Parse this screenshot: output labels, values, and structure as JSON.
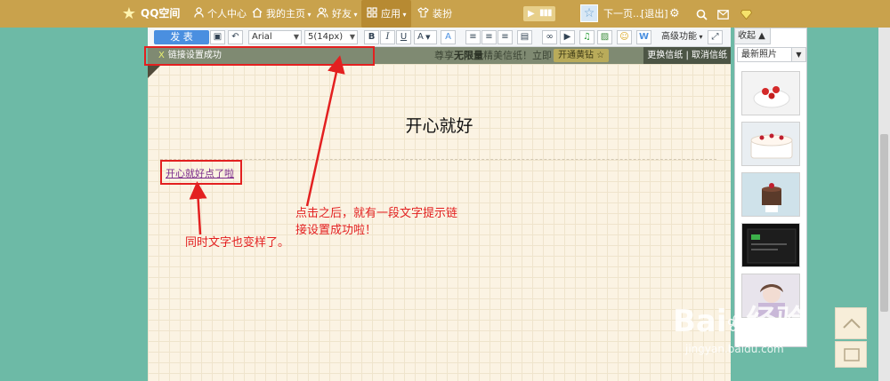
{
  "topbar": {
    "logo": "QQ空间",
    "nav": [
      {
        "label": "个人中心",
        "icon": "person-icon"
      },
      {
        "label": "我的主页",
        "icon": "home-icon"
      },
      {
        "label": "好友",
        "icon": "friends-icon"
      },
      {
        "label": "应用",
        "icon": "apps-icon"
      },
      {
        "label": "装扮",
        "icon": "shirt-icon"
      }
    ],
    "next_page": "下一页...",
    "logout": "[退出]"
  },
  "toolbar": {
    "publish": "发 表",
    "font_family": "Arial",
    "font_size": "5(14px)",
    "bold": "B",
    "italic": "I",
    "underline": "U",
    "font_color": "A",
    "advanced": "高级功能"
  },
  "notice": {
    "close": "X",
    "message": "链接设置成功",
    "promo_prefix": "尊享",
    "promo_bold": "无限量",
    "promo_suffix": "精美信纸！立即",
    "open_vip": "开通黄钻 ☆",
    "change_paper": "更换信纸",
    "separator": "|",
    "cancel_paper": "取消信纸"
  },
  "content": {
    "title": "开心就好",
    "link_text": "开心就好点了啦"
  },
  "annotations": {
    "note_right_line1": "点击之后，就有一段文字提示链",
    "note_right_line2": "接设置成功啦！",
    "note_left": "同时文字也变样了。"
  },
  "sidebar": {
    "tab": "收起 ▲",
    "filter": "最新照片"
  },
  "watermark": {
    "brand": "Bai",
    "brand_cn": "经验",
    "url": "jingyan.baidu.com"
  },
  "colors": {
    "topbar": "#c9a24c",
    "background": "#6dbaa6",
    "annotation_red": "#e32020",
    "publish_blue": "#4a8fe0"
  }
}
